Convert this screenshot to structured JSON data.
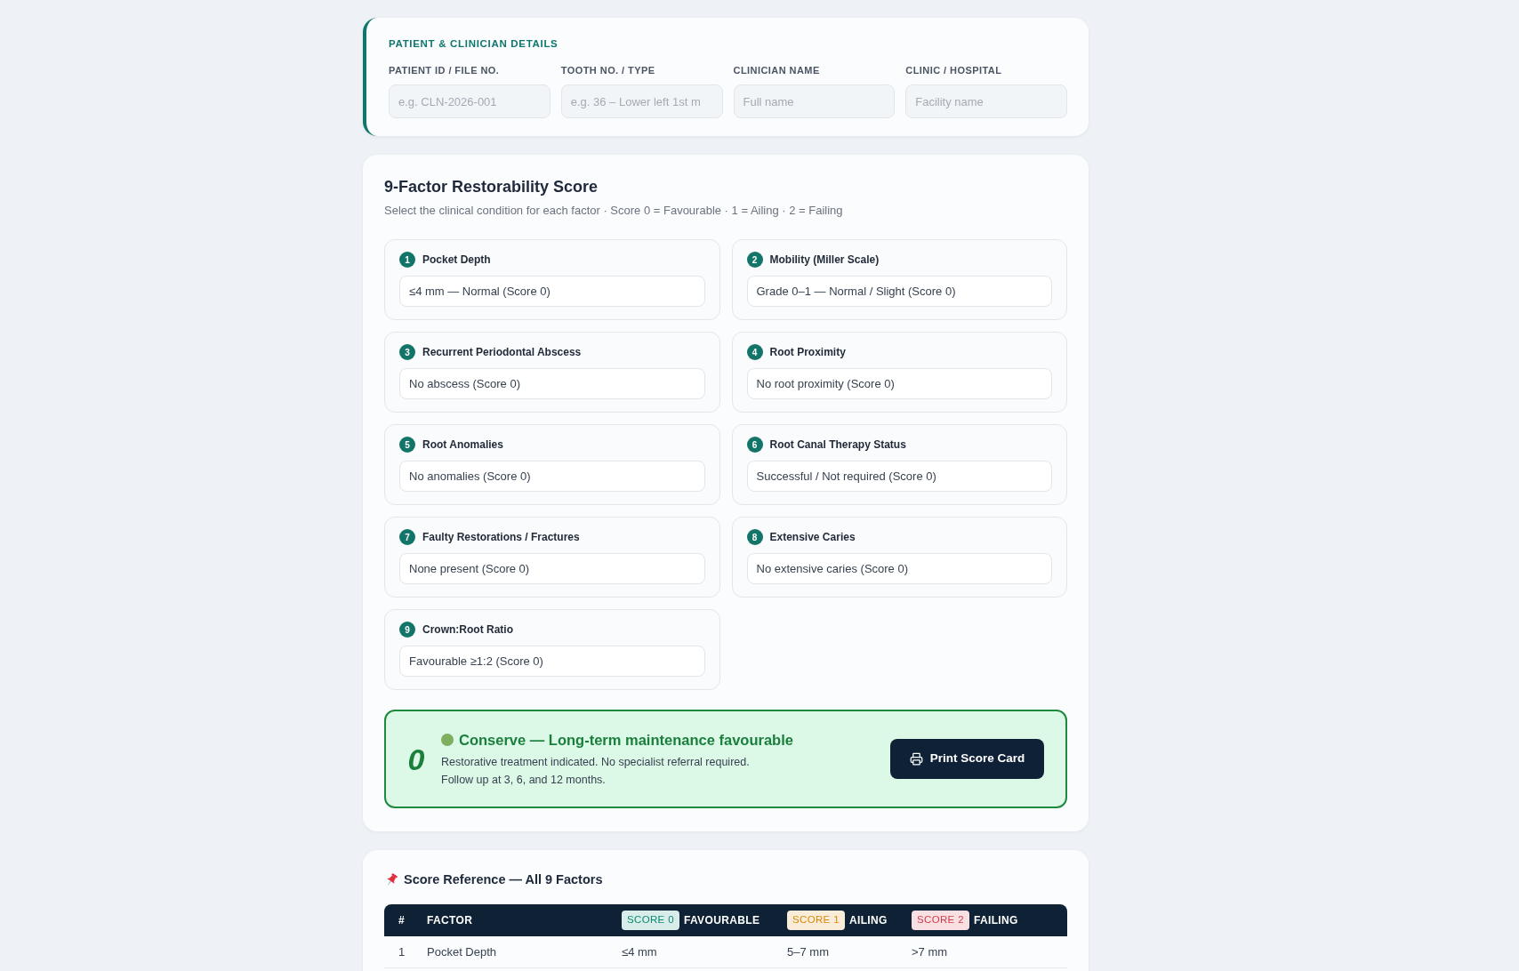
{
  "patient_details": {
    "title": "PATIENT & CLINICIAN DETAILS",
    "fields": [
      {
        "label": "PATIENT ID / FILE NO.",
        "placeholder": "e.g. CLN-2026-001"
      },
      {
        "label": "TOOTH NO. / TYPE",
        "placeholder": "e.g. 36 – Lower left 1st m"
      },
      {
        "label": "CLINICIAN NAME",
        "placeholder": "Full name"
      },
      {
        "label": "CLINIC / HOSPITAL",
        "placeholder": "Facility name"
      }
    ]
  },
  "restorability_score": {
    "title": "9-Factor Restorability Score",
    "subtitle": "Select the clinical condition for each factor · Score 0 = Favourable · 1 = Ailing · 2 = Failing",
    "factors": [
      {
        "number": "1",
        "label": "Pocket Depth",
        "value": "≤4 mm — Normal (Score 0)"
      },
      {
        "number": "2",
        "label": "Mobility (Miller Scale)",
        "value": "Grade 0–1 — Normal / Slight (Score 0)"
      },
      {
        "number": "3",
        "label": "Recurrent Periodontal Abscess",
        "value": "No abscess (Score 0)"
      },
      {
        "number": "4",
        "label": "Root Proximity",
        "value": "No root proximity (Score 0)"
      },
      {
        "number": "5",
        "label": "Root Anomalies",
        "value": "No anomalies (Score 0)"
      },
      {
        "number": "6",
        "label": "Root Canal Therapy Status",
        "value": "Successful / Not required (Score 0)"
      },
      {
        "number": "7",
        "label": "Faulty Restorations / Fractures",
        "value": "None present (Score 0)"
      },
      {
        "number": "8",
        "label": "Extensive Caries",
        "value": "No extensive caries (Score 0)"
      },
      {
        "number": "9",
        "label": "Crown:Root Ratio",
        "value": "Favourable ≥1:2 (Score 0)"
      }
    ],
    "result": {
      "score": "0",
      "title": "Conserve — Long-term maintenance favourable",
      "description_lines": [
        "Restorative treatment indicated. No specialist referral required.",
        "Follow up at 3, 6, and 12 months."
      ],
      "print_button": "Print Score Card"
    }
  },
  "score_reference": {
    "title": "Score Reference — All 9 Factors",
    "table": {
      "columns": [
        {
          "label": "#"
        },
        {
          "label": "FACTOR"
        },
        {
          "tag": "SCORE 0",
          "color": "#0d8a74",
          "label": "FAVOURABLE"
        },
        {
          "tag": "SCORE 1",
          "color": "#d98a0b",
          "label": "AILING"
        },
        {
          "tag": "SCORE 2",
          "color": "#d23b4b",
          "label": "FAILING"
        }
      ],
      "rows": [
        [
          "1",
          "Pocket Depth",
          "≤4 mm",
          "5–7 mm",
          ">7 mm"
        ]
      ]
    }
  }
}
